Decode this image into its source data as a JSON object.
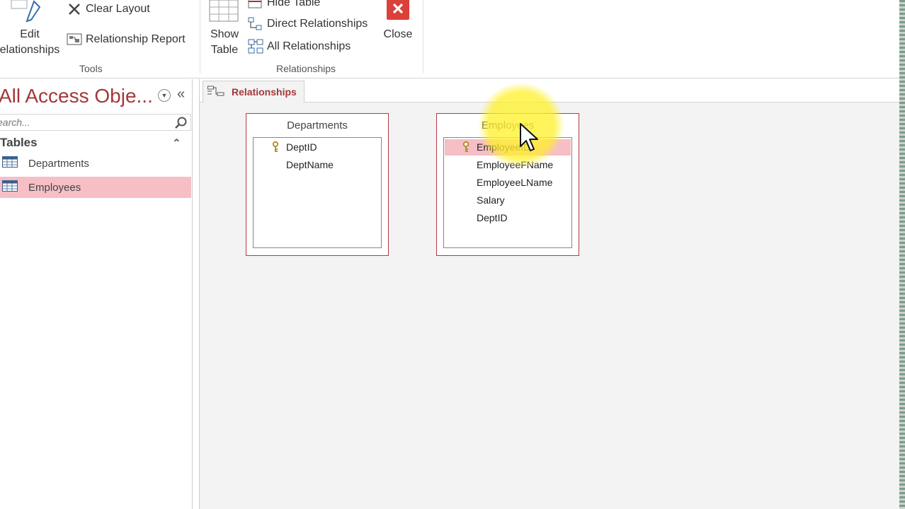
{
  "ribbon": {
    "edit_relationships_label_1": "Edit",
    "edit_relationships_label_2": "elationships",
    "clear_layout_label": "Clear Layout",
    "relationship_report_label": "Relationship Report",
    "tools_group_label": "Tools",
    "show_table_label_1": "Show",
    "show_table_label_2": "Table",
    "hide_table_label": "Hide Table",
    "direct_relationships_label": "Direct Relationships",
    "all_relationships_label": "All Relationships",
    "close_label": "Close",
    "relationships_group_label": "Relationships"
  },
  "nav": {
    "title": "All Access Obje...",
    "search_placeholder": "earch...",
    "section_label": "Tables",
    "items": [
      {
        "label": "Departments"
      },
      {
        "label": "Employees"
      }
    ]
  },
  "document": {
    "tab_label": "Relationships",
    "tables": [
      {
        "title": "Departments",
        "fields": [
          "DeptID",
          "DeptName"
        ]
      },
      {
        "title": "Employees",
        "fields": [
          "EmployeeID",
          "EmployeeFName",
          "EmployeeLName",
          "Salary",
          "DeptID"
        ]
      }
    ]
  },
  "colors": {
    "accent": "#a4373a",
    "selection": "#f5bfc5",
    "close_button": "#d9413a"
  }
}
